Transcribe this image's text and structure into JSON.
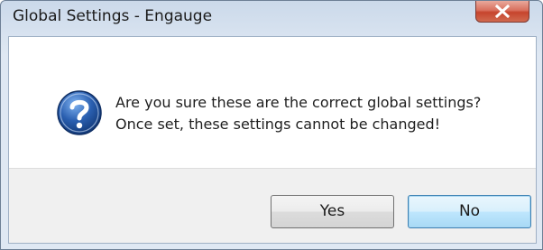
{
  "window": {
    "title": "Global Settings - Engauge"
  },
  "dialog": {
    "icon": "question-icon",
    "message_line1": "Are you sure these are the correct global settings?",
    "message_line2": "Once set, these settings cannot be changed!"
  },
  "buttons": {
    "yes_label": "Yes",
    "no_label": "No"
  },
  "colors": {
    "title_bar": "#dfe8f3",
    "close_button": "#c6442d",
    "focused_button_border": "#3c7fb1",
    "icon_blue": "#2a5fb0"
  }
}
